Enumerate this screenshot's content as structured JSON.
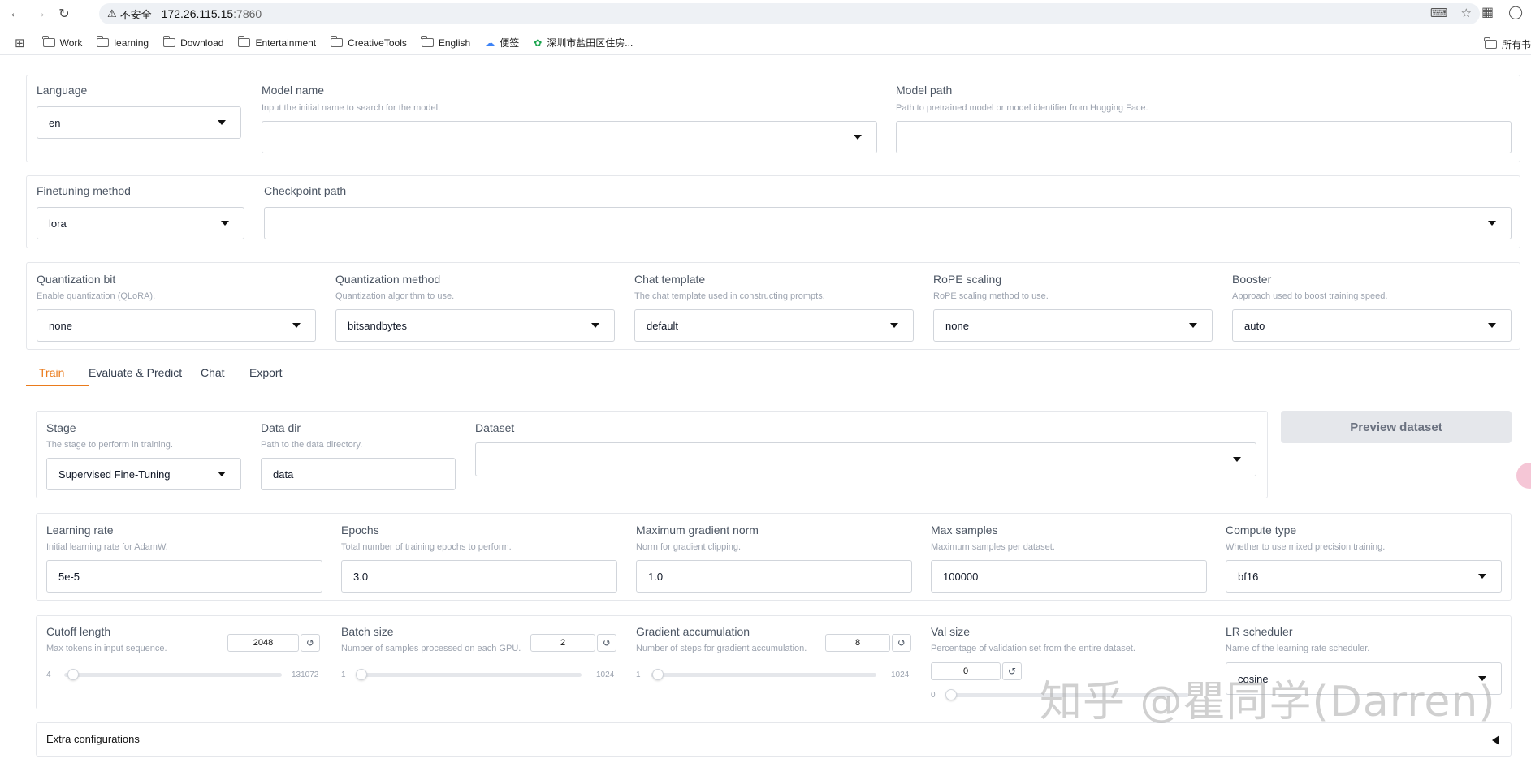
{
  "browser": {
    "insecure_label": "不安全",
    "url_host": "172.26.115.15",
    "url_port": ":7860",
    "bookmarks": [
      "Work",
      "learning",
      "Download",
      "Entertainment",
      "CreativeTools",
      "English",
      "便签",
      "深圳市盐田区住房...",
      "所有书"
    ]
  },
  "top_panel": {
    "language": {
      "label": "Language",
      "value": "en"
    },
    "model_name": {
      "label": "Model name",
      "info": "Input the initial name to search for the model.",
      "value": ""
    },
    "model_path": {
      "label": "Model path",
      "info": "Path to pretrained model or model identifier from Hugging Face.",
      "value": ""
    }
  },
  "finetune_panel": {
    "method": {
      "label": "Finetuning method",
      "value": "lora"
    },
    "checkpoint": {
      "label": "Checkpoint path",
      "value": ""
    }
  },
  "advanced_panel": {
    "quant_bit": {
      "label": "Quantization bit",
      "info": "Enable quantization (QLoRA).",
      "value": "none"
    },
    "quant_method": {
      "label": "Quantization method",
      "info": "Quantization algorithm to use.",
      "value": "bitsandbytes"
    },
    "chat_template": {
      "label": "Chat template",
      "info": "The chat template used in constructing prompts.",
      "value": "default"
    },
    "rope": {
      "label": "RoPE scaling",
      "info": "RoPE scaling method to use.",
      "value": "none"
    },
    "booster": {
      "label": "Booster",
      "info": "Approach used to boost training speed.",
      "value": "auto"
    }
  },
  "tabs": [
    "Train",
    "Evaluate & Predict",
    "Chat",
    "Export"
  ],
  "train": {
    "stage": {
      "label": "Stage",
      "info": "The stage to perform in training.",
      "value": "Supervised Fine-Tuning"
    },
    "data_dir": {
      "label": "Data dir",
      "info": "Path to the data directory.",
      "value": "data"
    },
    "dataset": {
      "label": "Dataset",
      "value": ""
    },
    "preview_button": "Preview dataset",
    "learning_rate": {
      "label": "Learning rate",
      "info": "Initial learning rate for AdamW.",
      "value": "5e-5"
    },
    "epochs": {
      "label": "Epochs",
      "info": "Total number of training epochs to perform.",
      "value": "3.0"
    },
    "max_grad_norm": {
      "label": "Maximum gradient norm",
      "info": "Norm for gradient clipping.",
      "value": "1.0"
    },
    "max_samples": {
      "label": "Max samples",
      "info": "Maximum samples per dataset.",
      "value": "100000"
    },
    "compute_type": {
      "label": "Compute type",
      "info": "Whether to use mixed precision training.",
      "value": "bf16"
    },
    "cutoff_len": {
      "label": "Cutoff length",
      "info": "Max tokens in input sequence.",
      "value": "2048",
      "min": "4",
      "max": "131072",
      "fraction": 0.0156
    },
    "batch_size": {
      "label": "Batch size",
      "info": "Number of samples processed on each GPU.",
      "value": "2",
      "min": "1",
      "max": "1024",
      "fraction": 0.001
    },
    "grad_accum": {
      "label": "Gradient accumulation",
      "info": "Number of steps for gradient accumulation.",
      "value": "8",
      "min": "1",
      "max": "1024",
      "fraction": 0.007
    },
    "val_size": {
      "label": "Val size",
      "info": "Percentage of validation set from the entire dataset.",
      "value": "0",
      "min": "0",
      "fraction": 0
    },
    "lr_scheduler": {
      "label": "LR scheduler",
      "info": "Name of the learning rate scheduler.",
      "value": "cosine"
    },
    "extra_config": "Extra configurations"
  },
  "watermark": "知乎 @瞿同学(Darren)",
  "colors": {
    "accent": "#ea7b1c",
    "border": "#e5e7eb",
    "muted": "#9ca3af"
  }
}
